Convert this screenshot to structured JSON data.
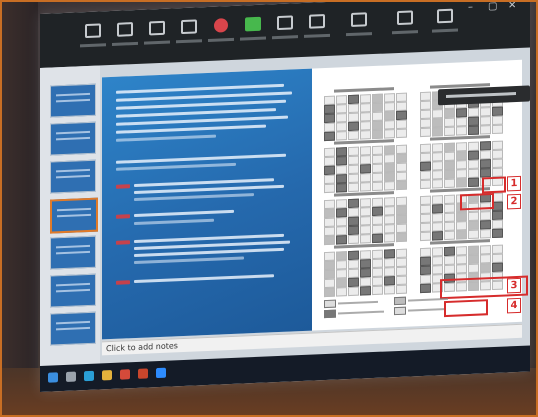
{
  "slide": {
    "notes_placeholder": "Click to add notes"
  },
  "calendar_markers": [
    "1",
    "2",
    "3",
    "4"
  ],
  "colors": {
    "frame_accent": "#c86e24",
    "slide_blue": "#2569ad",
    "highlight_red": "#d62c2c",
    "viewbar_green": "#3ca34a"
  },
  "icons": {
    "meeting_toolbar": [
      "microphone-icon",
      "video-icon",
      "security-icon",
      "participants-icon",
      "chat-icon",
      "share-screen-icon",
      "record-icon",
      "reactions-icon",
      "apps-icon",
      "whiteboard-icon",
      "more-icon"
    ],
    "taskbar": [
      "start-icon",
      "search-icon",
      "edge-icon",
      "explorer-icon",
      "chrome-icon",
      "powerpoint-icon",
      "zoom-icon"
    ]
  }
}
